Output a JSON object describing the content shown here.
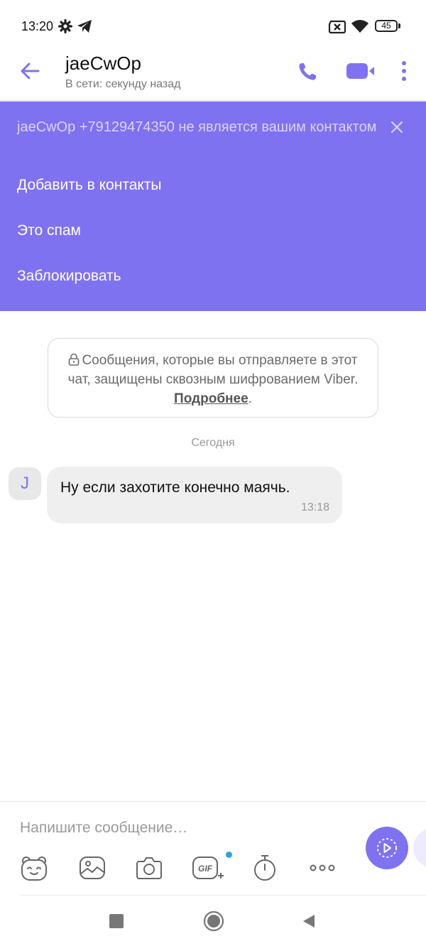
{
  "status_bar": {
    "time": "13:20",
    "battery_level": "45",
    "icons": [
      "gear-icon",
      "telegram-icon",
      "sim-error-icon",
      "wifi-icon",
      "battery-icon"
    ]
  },
  "header": {
    "title": "jaeCwOp",
    "subtitle": "В сети: секунду назад",
    "icons": [
      "back-arrow-icon",
      "phone-icon",
      "video-camera-icon",
      "more-vertical-icon"
    ]
  },
  "banner": {
    "note": "jaeCwOp +79129474350 не является вашим контактом",
    "actions": [
      "Добавить в контакты",
      "Это спам",
      "Заблокировать"
    ]
  },
  "encryption_notice": {
    "text": "Сообщения, которые вы отправляете в этот чат, защищены сквозным шифрованием Viber.",
    "link": "Подробнее",
    "suffix": "."
  },
  "date_separator": "Сегодня",
  "messages": [
    {
      "avatar_letter": "J",
      "text": "Ну если захотите конечно маячь.",
      "time": "13:18"
    }
  ],
  "composer": {
    "placeholder": "Напишите сообщение…",
    "tools": [
      "sticker-icon",
      "gallery-icon",
      "camera-icon",
      "gif-icon",
      "timer-icon",
      "more-horizontal-icon"
    ]
  },
  "colors": {
    "accent": "#7f72f0",
    "banner_note": "#d8d4fb",
    "bubble": "#efefef"
  }
}
